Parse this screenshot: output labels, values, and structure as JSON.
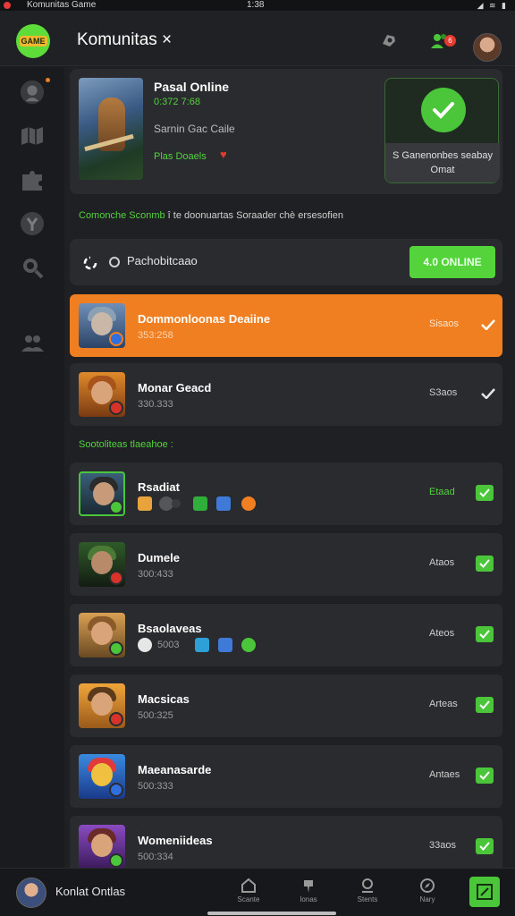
{
  "status_bar": {
    "app_title": "Komunitas Game",
    "time": "1:38",
    "signal": "◢ ≋ ▮"
  },
  "header": {
    "logo_text": "GAME",
    "title": "Komunitas ×",
    "notification_count": "6"
  },
  "featured": {
    "title": "Pasal Online",
    "subtitle": "0:372 7:68",
    "description": "Sarnin Gac Caile",
    "tag": "Plas Doaels",
    "status_label": "S Ganenonbes seabay Omat"
  },
  "hint": {
    "highlight": "Comonche Sconmb",
    "rest": "î te doonuartas Soraader chè ersesofien"
  },
  "online_bar": {
    "label": "Pachobitcaao",
    "button_label": "4.0 ONLINE"
  },
  "top_players": [
    {
      "name": "Dommonloonas Deaiine",
      "score": "353:258",
      "stat": "Sisaos",
      "active": true
    },
    {
      "name": "Monar Geacd",
      "score": "330.333",
      "stat": "S3aos",
      "active": false
    }
  ],
  "section_title": "Sootoliteas tlaeahoe :",
  "players": [
    {
      "name": "Rsadiat",
      "score": "",
      "stat": "Etaad"
    },
    {
      "name": "Dumele",
      "score": "300:433",
      "stat": "Ataos"
    },
    {
      "name": "Bsaolaveas",
      "score": "5003",
      "stat": "Ateos"
    },
    {
      "name": "Macsicas",
      "score": "500:325",
      "stat": "Arteas"
    },
    {
      "name": "Maeanasarde",
      "score": "500:333",
      "stat": "Antaes"
    },
    {
      "name": "Womeniideas",
      "score": "500:334",
      "stat": "33aos"
    }
  ],
  "bottom_bar": {
    "user": "Konlat Ontlas",
    "nav": [
      {
        "label": "Scante"
      },
      {
        "label": "Ionas"
      },
      {
        "label": "Stents"
      },
      {
        "label": "Nary"
      }
    ]
  }
}
